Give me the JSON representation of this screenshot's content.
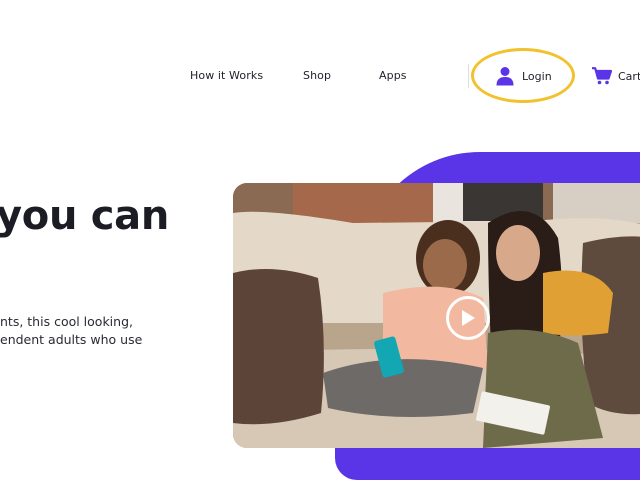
{
  "nav": {
    "items": [
      {
        "label": "How it Works"
      },
      {
        "label": "Shop"
      },
      {
        "label": "Apps"
      }
    ],
    "login_label": "Login",
    "cart_label": "Cart"
  },
  "hero": {
    "heading": "you can",
    "description_lines": [
      "nts, this cool looking,",
      "endent adults who use"
    ]
  },
  "video": {
    "icons": {
      "play": "play-icon",
      "login": "user-icon",
      "cart": "cart-icon"
    }
  },
  "colors": {
    "accent_purple": "#5a35e8",
    "highlight_yellow": "#f2c12e",
    "text_dark": "#1c1c24"
  }
}
